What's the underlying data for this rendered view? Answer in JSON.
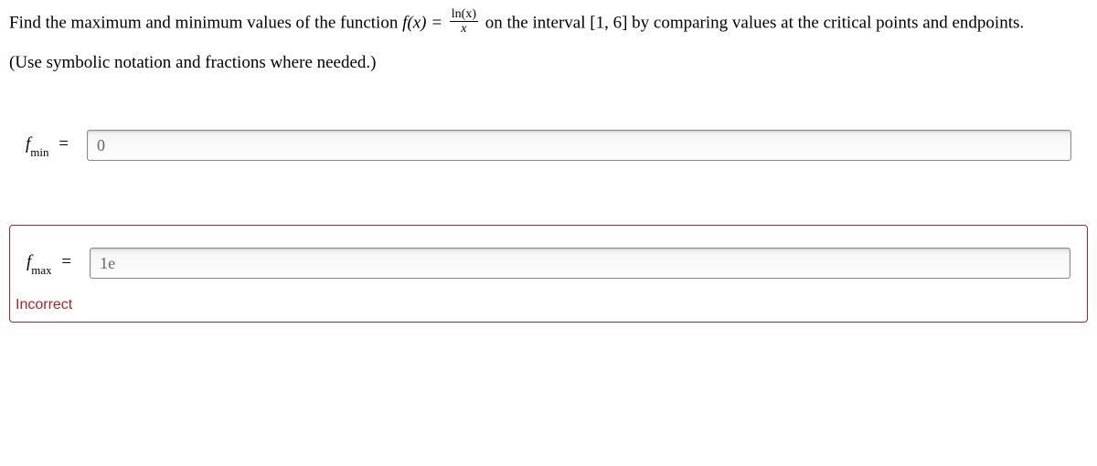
{
  "problem": {
    "text_part1": "Find the maximum and minimum values of the function ",
    "func_lhs": "f(x) = ",
    "frac_num": "ln(x)",
    "frac_den": "x",
    "text_part2": " on the interval [1, 6] by comparing values at the critical points and endpoints."
  },
  "instruction": "(Use symbolic notation and fractions where needed.)",
  "answers": {
    "fmin": {
      "label_f": "f",
      "label_sub": "min",
      "equals": " = ",
      "value": "0"
    },
    "fmax": {
      "label_f": "f",
      "label_sub": "max",
      "equals": " = ",
      "value": "1e"
    }
  },
  "feedback": {
    "incorrect": "Incorrect"
  }
}
